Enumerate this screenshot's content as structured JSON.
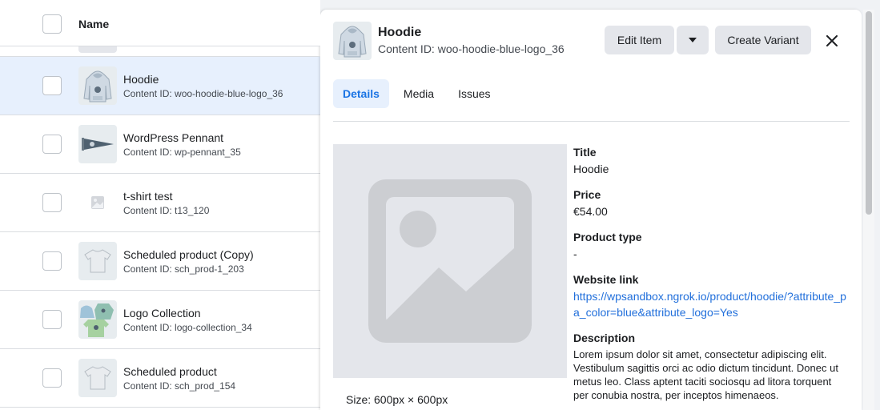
{
  "list": {
    "header": {
      "name_label": "Name"
    },
    "rows": [
      {
        "title": "Hoodie",
        "content_id": "Content ID: woo-hoodie-blue-logo_36",
        "thumb": "hoodie-icon",
        "selected": true
      },
      {
        "title": "WordPress Pennant",
        "content_id": "Content ID: wp-pennant_35",
        "thumb": "pennant-icon"
      },
      {
        "title": "t-shirt test",
        "content_id": "Content ID: t13_120",
        "thumb": "image-placeholder-icon"
      },
      {
        "title": "Scheduled product (Copy)",
        "content_id": "Content ID: sch_prod-1_203",
        "thumb": "tshirt-icon"
      },
      {
        "title": "Logo Collection",
        "content_id": "Content ID: logo-collection_34",
        "thumb": "logo-collection-icon"
      },
      {
        "title": "Scheduled product",
        "content_id": "Content ID: sch_prod_154",
        "thumb": "tshirt-icon"
      }
    ]
  },
  "panel": {
    "title": "Hoodie",
    "content_id": "Content ID: woo-hoodie-blue-logo_36",
    "buttons": {
      "edit": "Edit Item",
      "create_variant": "Create Variant"
    },
    "tabs": [
      "Details",
      "Media",
      "Issues"
    ],
    "active_tab": "Details",
    "image_size": "Size: 600px × 600px",
    "fields": {
      "title_label": "Title",
      "title_value": "Hoodie",
      "price_label": "Price",
      "price_value": "€54.00",
      "product_type_label": "Product type",
      "product_type_value": "-",
      "website_label": "Website link",
      "website_value": "https://wpsandbox.ngrok.io/product/hoodie/?attribute_pa_color=blue&attribute_logo=Yes",
      "description_label": "Description",
      "description_value": "Lorem ipsum dolor sit amet, consectetur adipiscing elit. Vestibulum sagittis orci ac odio dictum tincidunt. Donec ut metus leo. Class aptent taciti sociosqu ad litora torquent per conubia nostra, per inceptos himenaeos."
    }
  },
  "colors": {
    "accent": "#1b74e4",
    "link": "#216fdb",
    "selected_row": "#e7f0fd",
    "button_bg": "#e4e6eb"
  }
}
